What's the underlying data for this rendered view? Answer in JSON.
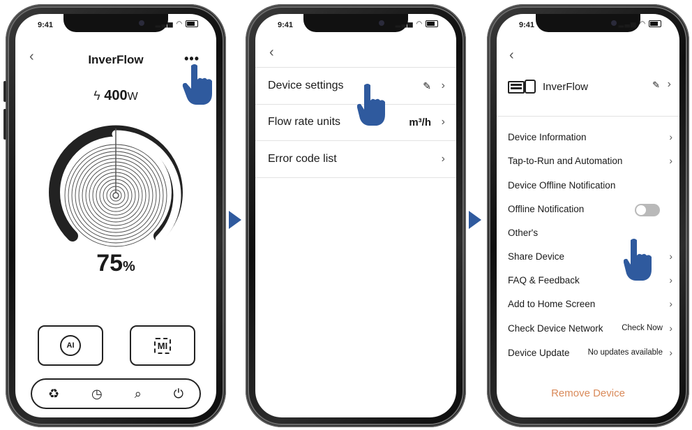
{
  "status": {
    "time": "9:41"
  },
  "screen1": {
    "title": "InverFlow",
    "back_icon": "chevron-left-icon",
    "more_label": "•••",
    "power_value": "400",
    "power_unit": "W",
    "gauge_percent_value": "75",
    "gauge_percent_unit": "%",
    "gauge_level": 0.75,
    "mode_buttons": [
      {
        "label": "AI",
        "icon": "ai-cycle-icon"
      },
      {
        "label": "MI",
        "icon": "mi-bracket-icon"
      }
    ],
    "tabbar": [
      {
        "icon": "recycle-icon",
        "glyph": "♻"
      },
      {
        "icon": "clock-icon",
        "glyph": "◷"
      },
      {
        "icon": "search-icon",
        "glyph": "⌕"
      },
      {
        "icon": "power-icon",
        "glyph": "⏻"
      }
    ]
  },
  "screen2": {
    "rows": [
      {
        "label": "Device settings",
        "value": "",
        "edit": true
      },
      {
        "label": "Flow rate units",
        "value": "m³/h",
        "edit": false
      },
      {
        "label": "Error code list",
        "value": "",
        "edit": false
      }
    ]
  },
  "screen3": {
    "device_name": "InverFlow",
    "items": [
      {
        "label": "Device Information",
        "value": "",
        "chevron": true,
        "toggle": false
      },
      {
        "label": "Tap-to-Run and Automation",
        "value": "",
        "chevron": true,
        "toggle": false
      },
      {
        "label": "Device Offline Notification",
        "value": "",
        "chevron": false,
        "toggle": false
      },
      {
        "label": "Offline Notification",
        "value": "",
        "chevron": false,
        "toggle": true
      },
      {
        "label": "Other's",
        "value": "",
        "chevron": false,
        "toggle": false
      },
      {
        "label": "Share Device",
        "value": "",
        "chevron": true,
        "toggle": false
      },
      {
        "label": "FAQ & Feedback",
        "value": "",
        "chevron": true,
        "toggle": false
      },
      {
        "label": "Add to Home Screen",
        "value": "",
        "chevron": true,
        "toggle": false
      },
      {
        "label": "Check Device Network",
        "value": "Check Now",
        "chevron": true,
        "toggle": false
      },
      {
        "label": "Device Update",
        "value": "No updates available",
        "chevron": true,
        "toggle": false
      }
    ],
    "remove_label": "Remove Device"
  },
  "colors": {
    "accent_blue": "#2f5a9e",
    "remove_orange": "#d98a5a",
    "toggle_off": "#b9b9b9"
  }
}
